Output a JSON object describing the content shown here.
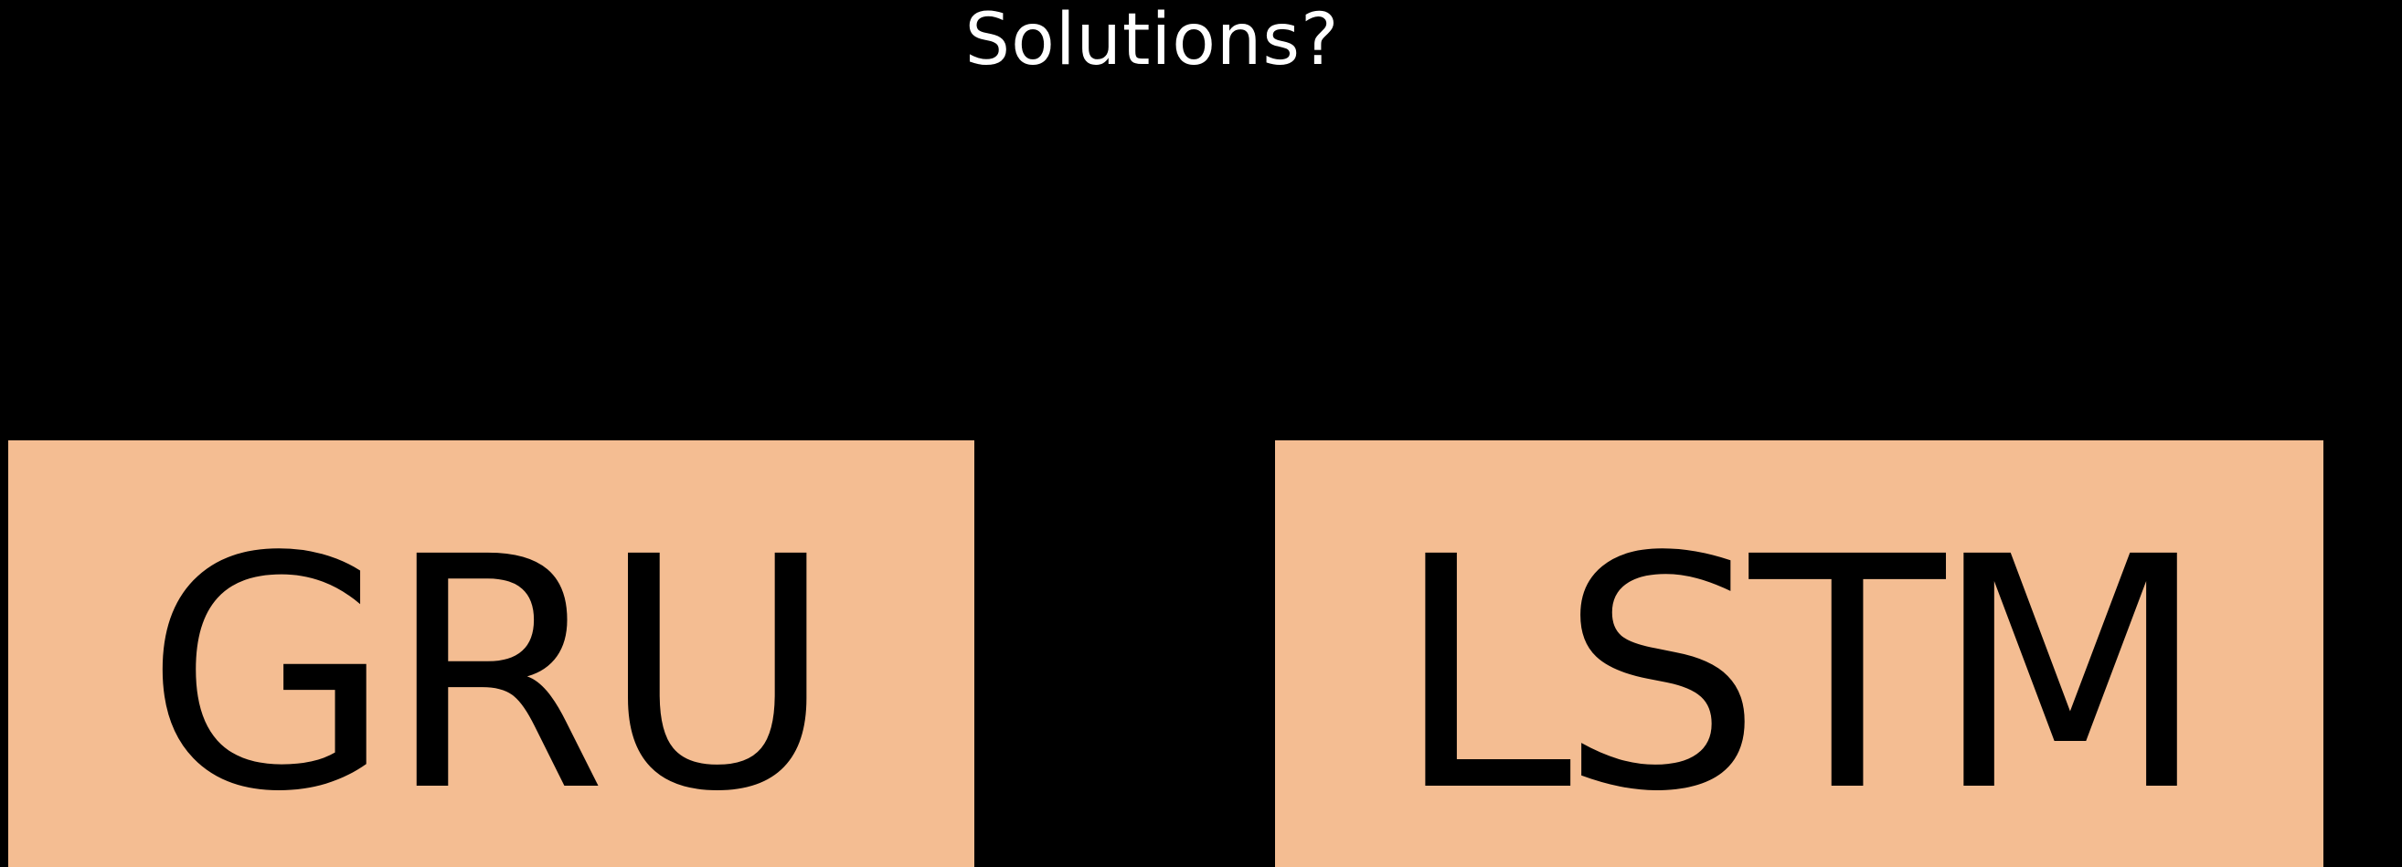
{
  "slide": {
    "title": "Solutions?",
    "background_color": "#000000",
    "box_color": "#f4bd92",
    "options": [
      {
        "label": "GRU"
      },
      {
        "label": "LSTM"
      }
    ]
  }
}
